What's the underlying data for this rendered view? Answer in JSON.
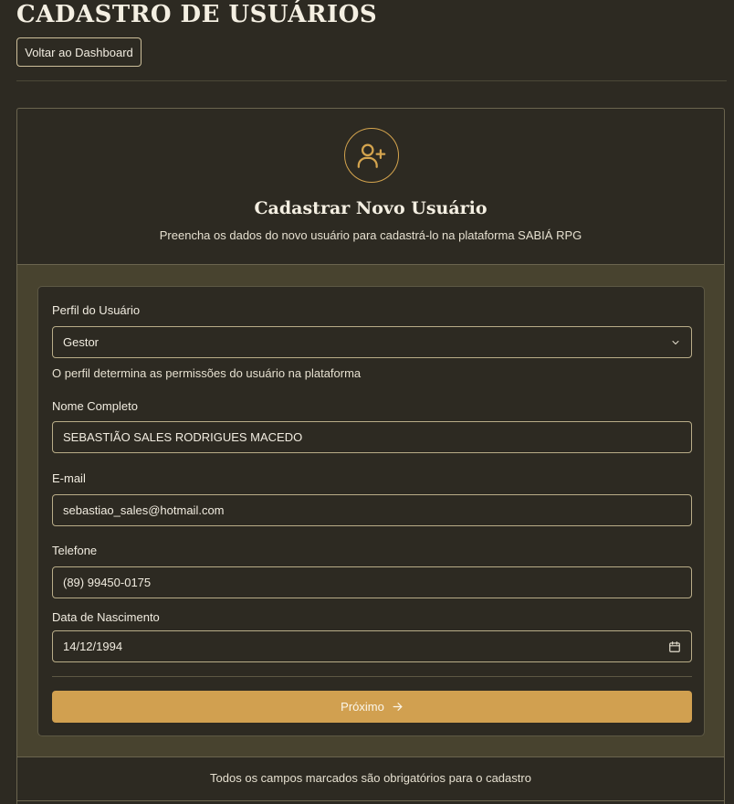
{
  "page": {
    "title": "CADASTRO DE USUÁRIOS",
    "back_button": "Voltar ao Dashboard"
  },
  "card": {
    "header_icon": "user-plus-icon",
    "title": "Cadastrar Novo Usuário",
    "subtitle": "Preencha os dados do novo usuário para cadastrá-lo na plataforma SABIÁ RPG",
    "footer_note": "Todos os campos marcados são obrigatórios para o cadastro"
  },
  "form": {
    "profile": {
      "label": "Perfil do Usuário",
      "value": "Gestor",
      "hint": "O perfil determina as permissões do usuário na plataforma",
      "icon": "chevron-down-icon"
    },
    "name": {
      "label": "Nome Completo",
      "value": "SEBASTIÃO SALES RODRIGUES MACEDO"
    },
    "email": {
      "label": "E-mail",
      "value": "sebastiao_sales@hotmail.com"
    },
    "phone": {
      "label": "Telefone",
      "value": "(89) 99450-0175"
    },
    "birthdate": {
      "label": "Data de Nascimento",
      "value": "14/12/1994",
      "icon": "calendar-icon"
    },
    "next_button": {
      "label": "Próximo",
      "icon": "arrow-right-icon"
    }
  },
  "colors": {
    "background": "#2d2a22",
    "accent": "#d1a050",
    "panel": "#48432f",
    "border": "#b9ad88"
  }
}
